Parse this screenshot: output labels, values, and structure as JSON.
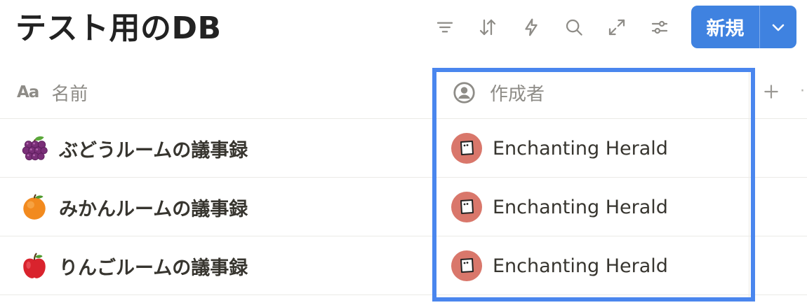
{
  "database": {
    "title": "テスト用のDB"
  },
  "toolbar": {
    "icons": [
      "filter-icon",
      "sort-icon",
      "automation-icon",
      "search-icon",
      "expand-icon",
      "settings-icon"
    ],
    "new_label": "新規"
  },
  "table": {
    "columns": [
      {
        "name": "名前",
        "icon": "title-aa-icon",
        "icon_text": "Aa"
      },
      {
        "name": "作成者",
        "icon": "person-icon"
      }
    ],
    "add_column_icon": "plus-icon",
    "rows": [
      {
        "emoji": "grapes",
        "name": "ぶどうルームの議事録",
        "author": "Enchanting Herald"
      },
      {
        "emoji": "orange",
        "name": "みかんルームの議事録",
        "author": "Enchanting Herald"
      },
      {
        "emoji": "apple",
        "name": "りんごルームの議事録",
        "author": "Enchanting Herald"
      }
    ]
  },
  "colors": {
    "accent": "#3f82e0",
    "highlight_border": "#4a86ee",
    "avatar_bg": "#d9776b",
    "muted_text": "#8e8c87"
  }
}
